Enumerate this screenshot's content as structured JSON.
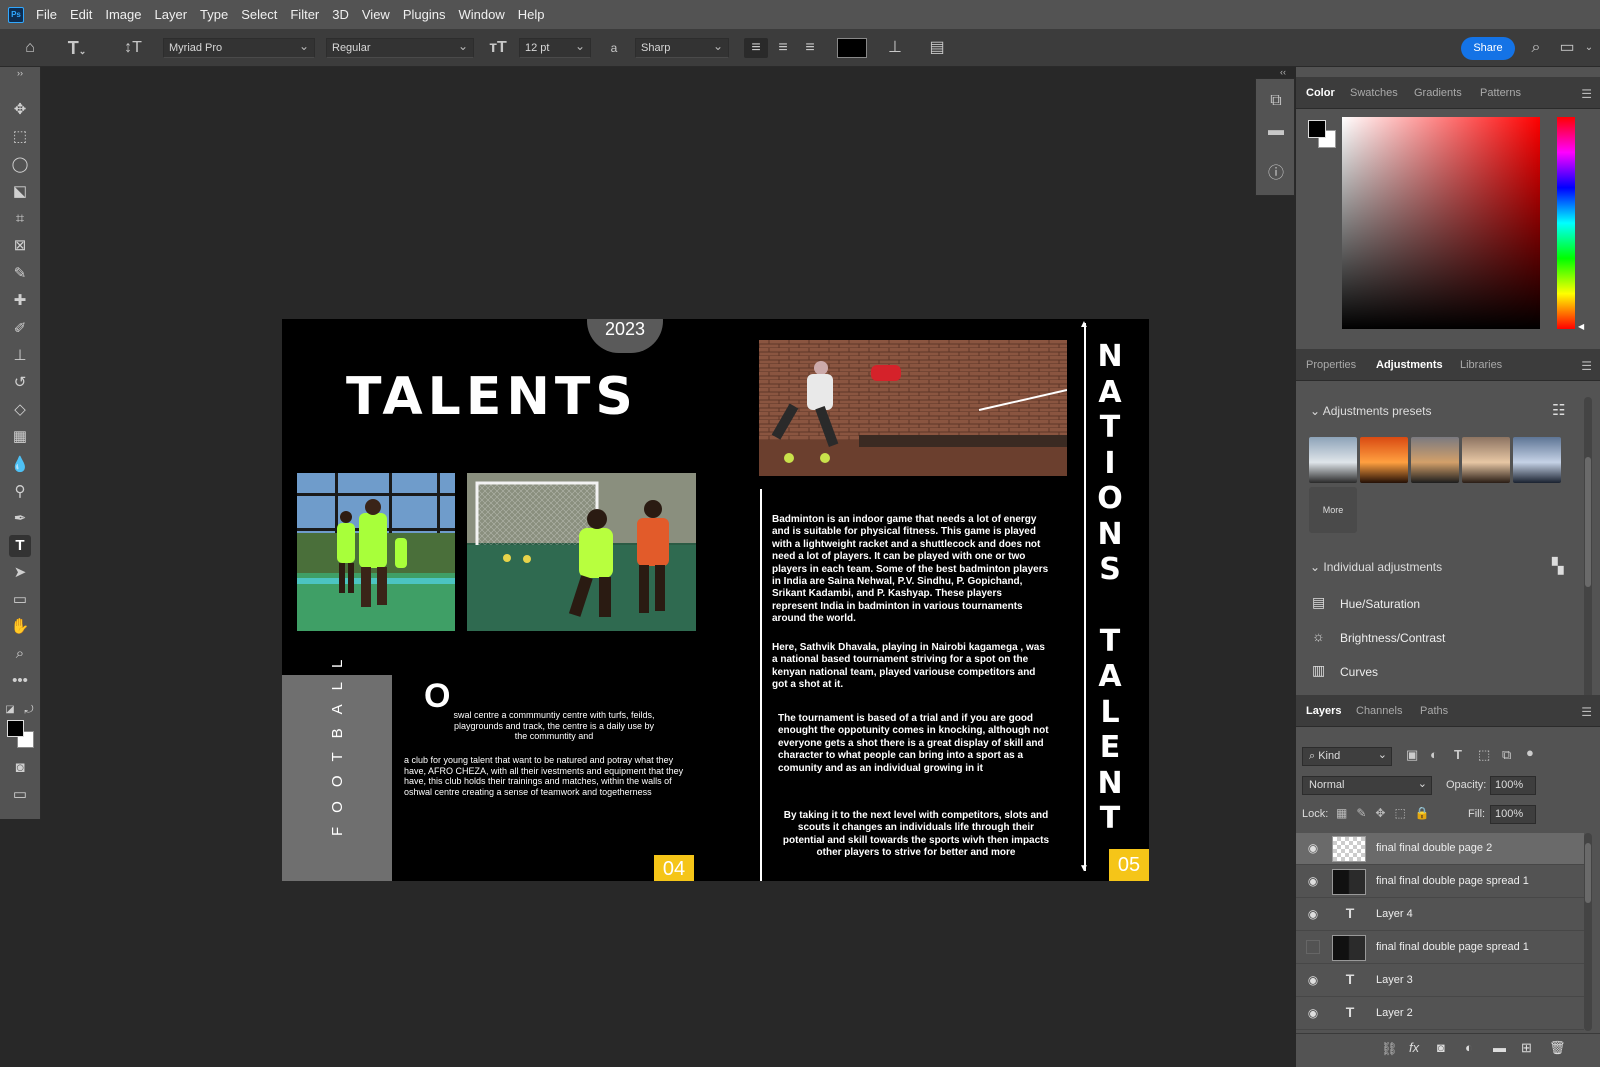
{
  "app": {
    "logo": "Ps"
  },
  "menu": [
    "File",
    "Edit",
    "Image",
    "Layer",
    "Type",
    "Select",
    "Filter",
    "3D",
    "View",
    "Plugins",
    "Window",
    "Help"
  ],
  "options": {
    "font_family": "Myriad Pro",
    "font_style": "Regular",
    "font_size": "12 pt",
    "antialias_label": "a",
    "antialias": "Sharp",
    "share_label": "Share",
    "text_color": "#000000"
  },
  "color_panel": {
    "tabs": [
      "Color",
      "Swatches",
      "Gradients",
      "Patterns"
    ],
    "active_tab": "Color",
    "hue_base": "#ff0000"
  },
  "adjust_panel": {
    "tabs": [
      "Properties",
      "Adjustments",
      "Libraries"
    ],
    "active_tab": "Adjustments",
    "presets_title": "Adjustments presets",
    "more_label": "More",
    "individual_title": "Individual adjustments",
    "items": [
      "Hue/Saturation",
      "Brightness/Contrast",
      "Curves"
    ]
  },
  "layers_panel": {
    "tabs": [
      "Layers",
      "Channels",
      "Paths"
    ],
    "active_tab": "Layers",
    "kind_label": "Kind",
    "blend_mode": "Normal",
    "opacity_label": "Opacity:",
    "opacity_value": "100%",
    "lock_label": "Lock:",
    "fill_label": "Fill:",
    "fill_value": "100%",
    "layers": [
      {
        "name": "final final double page 2",
        "type": "image",
        "visible": true,
        "selected": true
      },
      {
        "name": "final final double page spread 1",
        "type": "image",
        "visible": true,
        "selected": false
      },
      {
        "name": "Layer 4",
        "type": "text",
        "visible": true,
        "selected": false
      },
      {
        "name": "final final double page spread 1",
        "type": "image",
        "visible": false,
        "selected": false
      },
      {
        "name": "Layer 3",
        "type": "text",
        "visible": true,
        "selected": false
      },
      {
        "name": "Layer 2",
        "type": "text",
        "visible": true,
        "selected": false
      }
    ]
  },
  "document": {
    "year": "2023",
    "title": "TALENTS",
    "dropcap": "O",
    "para_left_1": "swal centre a commmuntiy centre with turfs, feilds, playgrounds and track, the centre is a daily use by the communtity and",
    "para_left_2": "a club for young talent that want to be natured and potray what they have, AFRO CHEZA, with all their ivestments and equipment that they have, this club holds their trainings and matches, within the walls of oshwal centre creating a sense of teamwork and togetherness",
    "side_word": "FOOTBALL",
    "page_left": "04",
    "page_right": "05",
    "vertical_title": "NATIONS TALENT",
    "para_right_1": "Badminton is an indoor game that needs a lot of energy and is suitable for physical fitness. This game is played with a lightweight racket and a shuttlecock and does not need a lot of players. It can be played with one or two players in each team. Some of the best badminton players in India are Saina Nehwal, P.V. Sindhu, P. Gopichand, Srikant Kadambi, and P. Kashyap. These players represent India in badminton in various tournaments around the world.",
    "para_right_2": "Here, Sathvik Dhavala, playing in Nairobi kagamega , was a national based tournament striving for a spot on the kenyan national team, played variouse competitors and got a shot at it.",
    "para_right_3": "The tournament is based of a trial and if you are good enought the oppotunity comes in knocking, although not everyone gets a shot there is a great display of skill and character to what people can bring into a sport as a comunity and as an individual growing in it",
    "para_right_4": "By taking it to the next level with competitors, slots and scouts it changes an individuals life through their potential and skill towards the sports wivh then impacts other players to strive for better and more",
    "accent_color": "#f5c518"
  }
}
